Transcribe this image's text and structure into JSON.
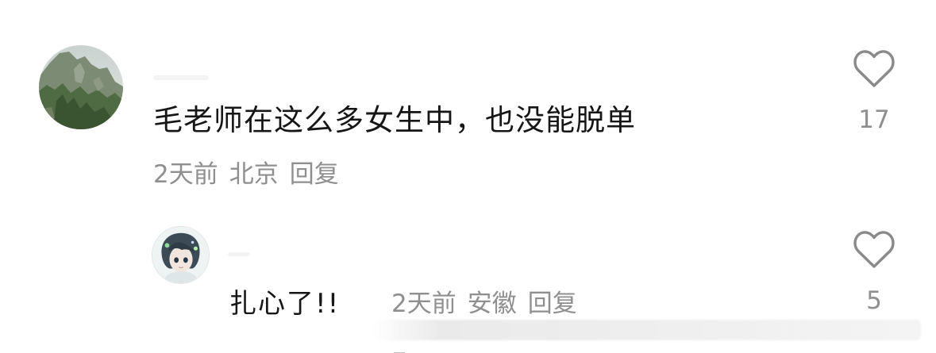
{
  "comments": [
    {
      "text": "毛老师在这么多女生中，也没能脱单",
      "time": "2天前",
      "location": "北京",
      "reply_label": "回复",
      "like_count": "17",
      "like_icon": "heart-outline-icon"
    }
  ],
  "replies": [
    {
      "text": "扎心了!!",
      "time": "2天前",
      "location": "安徽",
      "reply_label": "回复",
      "like_count": "5",
      "like_icon": "heart-outline-icon"
    }
  ],
  "colors": {
    "text_primary": "#161616",
    "text_secondary": "#8f8f8f",
    "background": "#ffffff"
  }
}
